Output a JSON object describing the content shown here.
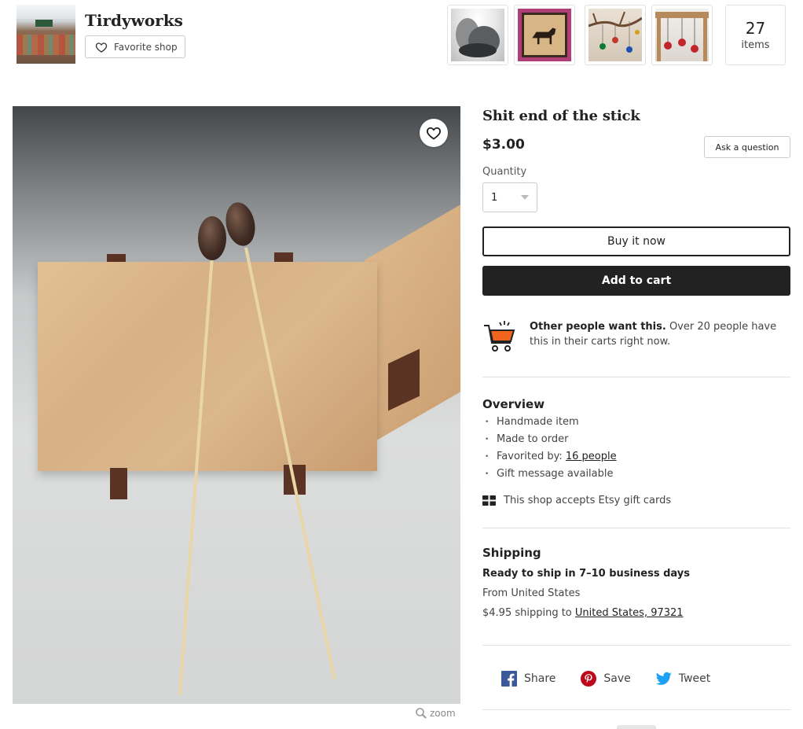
{
  "shop": {
    "name": "Tirdyworks",
    "favorite_label": "Favorite shop",
    "item_count": "27",
    "item_count_label": "items"
  },
  "listing": {
    "title": "Shit end of the stick",
    "price": "$3.00",
    "ask_question_label": "Ask a question",
    "quantity_label": "Quantity",
    "quantity_value": "1",
    "buy_now_label": "Buy it now",
    "add_to_cart_label": "Add to cart"
  },
  "demand": {
    "bold": "Other people want this.",
    "text": " Over 20 people have this in their carts right now."
  },
  "overview": {
    "title": "Overview",
    "items": [
      "Handmade item",
      "Made to order",
      "Favorited by: ",
      "Gift message available"
    ],
    "favorited_link": "16 people",
    "gift_card_text": "This shop accepts Etsy gift cards"
  },
  "shipping": {
    "title": "Shipping",
    "ready": "Ready to ship in 7–10 business days",
    "from": "From United States",
    "cost_prefix": "$4.95 shipping to ",
    "cost_location": "United States, 97321"
  },
  "share": {
    "facebook_label": "Share",
    "pinterest_label": "Save",
    "twitter_label": "Tweet"
  },
  "zoom_label": "zoom",
  "colors": {
    "accent_dark": "#222222",
    "facebook": "#3b5998",
    "pinterest": "#bd081c",
    "twitter": "#1da1f2",
    "cart_orange": "#f1641e"
  }
}
